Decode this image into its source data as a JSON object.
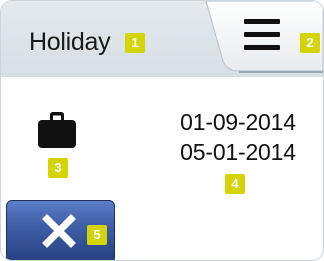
{
  "header": {
    "title": "Holiday",
    "colors": {
      "background": "#dfe6ea",
      "tab": "#f2f4f5"
    }
  },
  "menu_button": {
    "icon": "hamburger-menu-icon"
  },
  "holiday": {
    "icon": "suitcase-icon",
    "start_date": "01-09-2014",
    "end_date": "05-01-2014"
  },
  "close_button": {
    "icon": "close-icon",
    "color": "#3a5aa6"
  },
  "callouts": [
    "1",
    "2",
    "3",
    "4",
    "5"
  ]
}
